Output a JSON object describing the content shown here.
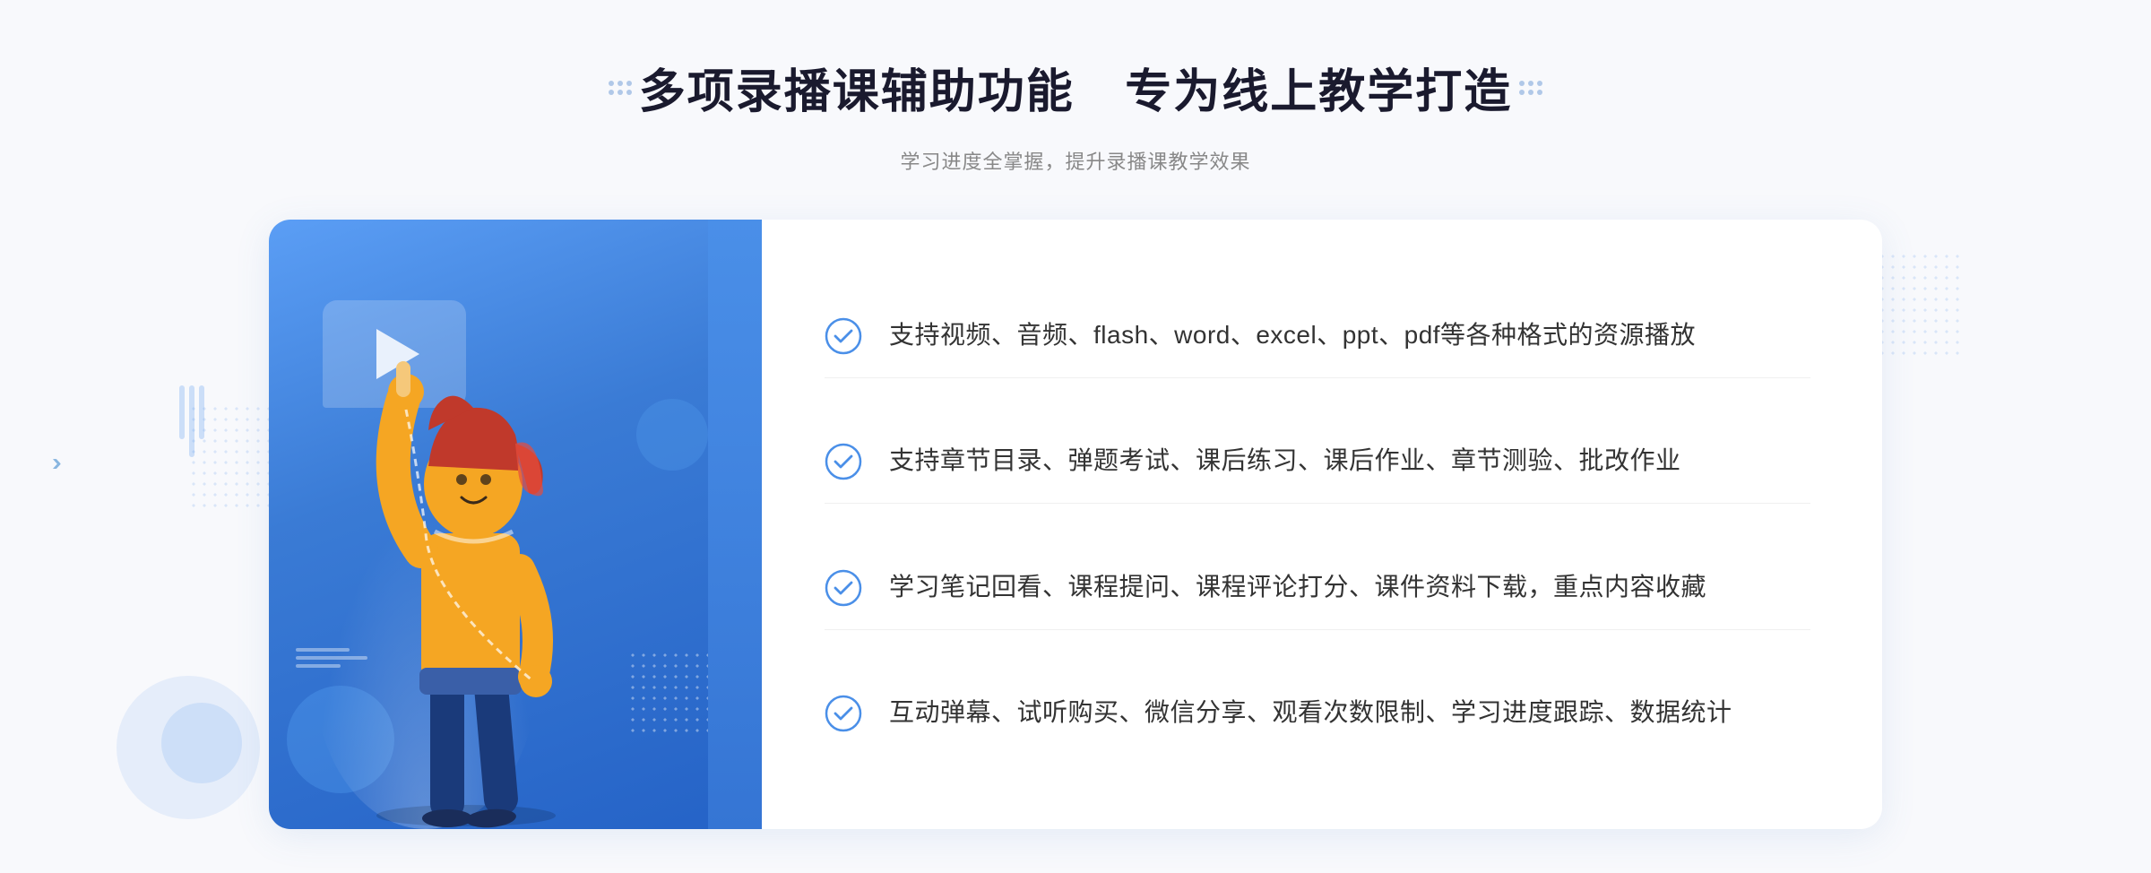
{
  "page": {
    "background_color": "#f7f9fc"
  },
  "header": {
    "title": "多项录播课辅助功能 专为线上教学打造",
    "subtitle": "学习进度全掌握，提升录播课教学效果",
    "title_part1": "多项录播课辅助功能",
    "title_part2": "专为线上教学打造"
  },
  "features": [
    {
      "id": 1,
      "text": "支持视频、音频、flash、word、excel、ppt、pdf等各种格式的资源播放"
    },
    {
      "id": 2,
      "text": "支持章节目录、弹题考试、课后练习、课后作业、章节测验、批改作业"
    },
    {
      "id": 3,
      "text": "学习笔记回看、课程提问、课程评论打分、课件资料下载，重点内容收藏"
    },
    {
      "id": 4,
      "text": "互动弹幕、试听购买、微信分享、观看次数限制、学习进度跟踪、数据统计"
    }
  ],
  "icons": {
    "check_color": "#4a8fe8",
    "arrow_left": "《",
    "dot_color": "#b0c8e8"
  }
}
